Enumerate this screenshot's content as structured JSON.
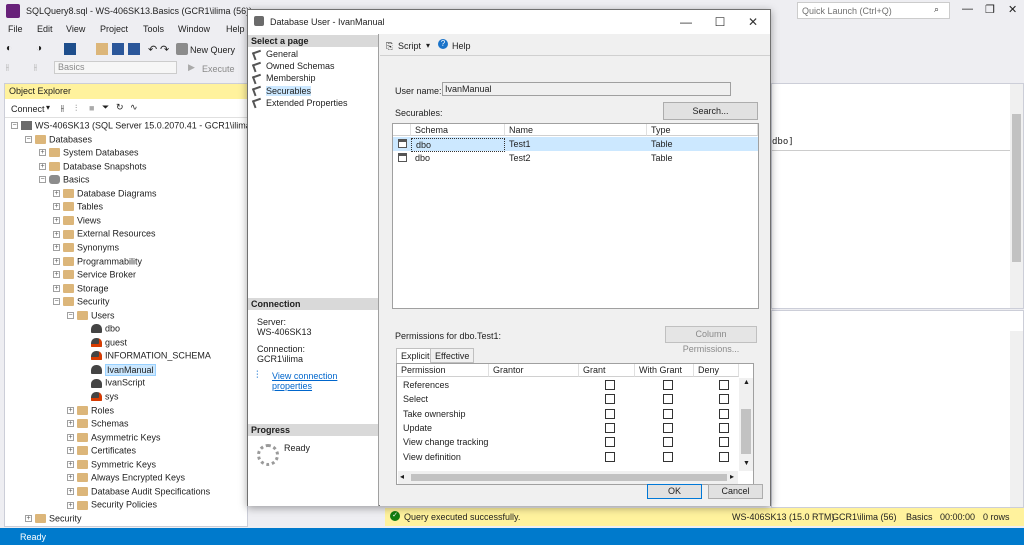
{
  "window": {
    "title": "SQLQuery8.sql - WS-406SK13.Basics (GCR1\\ilima (56))",
    "quick_launch_placeholder": "Quick Launch (Ctrl+Q)"
  },
  "menu": [
    "File",
    "Edit",
    "View",
    "Project",
    "Tools",
    "Window",
    "Help"
  ],
  "toolbar": {
    "new_query": "New Query",
    "database": "Basics",
    "execute": "Execute"
  },
  "object_explorer": {
    "title": "Object Explorer",
    "connect_label": "Connect",
    "tree": [
      {
        "label": "WS-406SK13 (SQL Server 15.0.2070.41 - GCR1\\ilima)",
        "icon": "server-icon",
        "level": 0,
        "expand": "-"
      },
      {
        "label": "Databases",
        "icon": "folder-icon",
        "level": 1,
        "expand": "-"
      },
      {
        "label": "System Databases",
        "icon": "folder-icon",
        "level": 2,
        "expand": "+"
      },
      {
        "label": "Database Snapshots",
        "icon": "folder-icon",
        "level": 2,
        "expand": "+"
      },
      {
        "label": "Basics",
        "icon": "database-icon",
        "level": 2,
        "expand": "-"
      },
      {
        "label": "Database Diagrams",
        "icon": "folder-icon",
        "level": 3,
        "expand": "+"
      },
      {
        "label": "Tables",
        "icon": "folder-icon",
        "level": 3,
        "expand": "+"
      },
      {
        "label": "Views",
        "icon": "folder-icon",
        "level": 3,
        "expand": "+"
      },
      {
        "label": "External Resources",
        "icon": "folder-icon",
        "level": 3,
        "expand": "+"
      },
      {
        "label": "Synonyms",
        "icon": "folder-icon",
        "level": 3,
        "expand": "+"
      },
      {
        "label": "Programmability",
        "icon": "folder-icon",
        "level": 3,
        "expand": "+"
      },
      {
        "label": "Service Broker",
        "icon": "folder-icon",
        "level": 3,
        "expand": "+"
      },
      {
        "label": "Storage",
        "icon": "folder-icon",
        "level": 3,
        "expand": "+"
      },
      {
        "label": "Security",
        "icon": "folder-icon",
        "level": 3,
        "expand": "-"
      },
      {
        "label": "Users",
        "icon": "folder-icon",
        "level": 4,
        "expand": "-"
      },
      {
        "label": "dbo",
        "icon": "user-icon",
        "level": 5,
        "expand": ""
      },
      {
        "label": "guest",
        "icon": "user-disabled-icon",
        "level": 5,
        "expand": ""
      },
      {
        "label": "INFORMATION_SCHEMA",
        "icon": "user-disabled-icon",
        "level": 5,
        "expand": ""
      },
      {
        "label": "IvanManual",
        "icon": "user-icon",
        "level": 5,
        "expand": "",
        "selected": true
      },
      {
        "label": "IvanScript",
        "icon": "user-icon",
        "level": 5,
        "expand": ""
      },
      {
        "label": "sys",
        "icon": "user-disabled-icon",
        "level": 5,
        "expand": ""
      },
      {
        "label": "Roles",
        "icon": "folder-icon",
        "level": 4,
        "expand": "+"
      },
      {
        "label": "Schemas",
        "icon": "folder-icon",
        "level": 4,
        "expand": "+"
      },
      {
        "label": "Asymmetric Keys",
        "icon": "folder-icon",
        "level": 4,
        "expand": "+"
      },
      {
        "label": "Certificates",
        "icon": "folder-icon",
        "level": 4,
        "expand": "+"
      },
      {
        "label": "Symmetric Keys",
        "icon": "folder-icon",
        "level": 4,
        "expand": "+"
      },
      {
        "label": "Always Encrypted Keys",
        "icon": "folder-icon",
        "level": 4,
        "expand": "+"
      },
      {
        "label": "Database Audit Specifications",
        "icon": "folder-icon",
        "level": 4,
        "expand": "+"
      },
      {
        "label": "Security Policies",
        "icon": "folder-icon",
        "level": 4,
        "expand": "+"
      },
      {
        "label": "Security",
        "icon": "folder-icon",
        "level": 1,
        "expand": "+"
      }
    ]
  },
  "editor": {
    "visible_text": "dbo]"
  },
  "query_status": {
    "message": "Query executed successfully.",
    "server": "WS-406SK13 (15.0 RTM)",
    "user": "GCR1\\ilima (56)",
    "database": "Basics",
    "elapsed": "00:00:00",
    "rows": "0 rows"
  },
  "app_status": "Ready",
  "dialog": {
    "title": "Database User - IvanManual",
    "select_page_header": "Select a page",
    "pages": [
      "General",
      "Owned Schemas",
      "Membership",
      "Securables",
      "Extended Properties"
    ],
    "active_page": "Securables",
    "connection_header": "Connection",
    "server_label": "Server:",
    "server_value": "WS-406SK13",
    "connection_label": "Connection:",
    "connection_value": "GCR1\\ilima",
    "view_connection_link": "View connection properties",
    "progress_header": "Progress",
    "progress_status": "Ready",
    "script_label": "Script",
    "help_label": "Help",
    "user_name_label": "User name:",
    "user_name_value": "IvanManual",
    "securables_label": "Securables:",
    "search_button": "Search...",
    "securables_columns": [
      "Schema",
      "Name",
      "Type"
    ],
    "securables_rows": [
      {
        "schema": "dbo",
        "name": "Test1",
        "type": "Table",
        "selected": true
      },
      {
        "schema": "dbo",
        "name": "Test2",
        "type": "Table",
        "selected": false
      }
    ],
    "permissions_label": "Permissions for dbo.Test1:",
    "column_permissions_button": "Column Permissions...",
    "permission_tabs": [
      "Explicit",
      "Effective"
    ],
    "active_permission_tab": "Explicit",
    "permission_columns": [
      "Permission",
      "Grantor",
      "Grant",
      "With Grant",
      "Deny"
    ],
    "permission_rows": [
      "References",
      "Select",
      "Take ownership",
      "Update",
      "View change tracking",
      "View definition"
    ],
    "ok_button": "OK",
    "cancel_button": "Cancel"
  }
}
